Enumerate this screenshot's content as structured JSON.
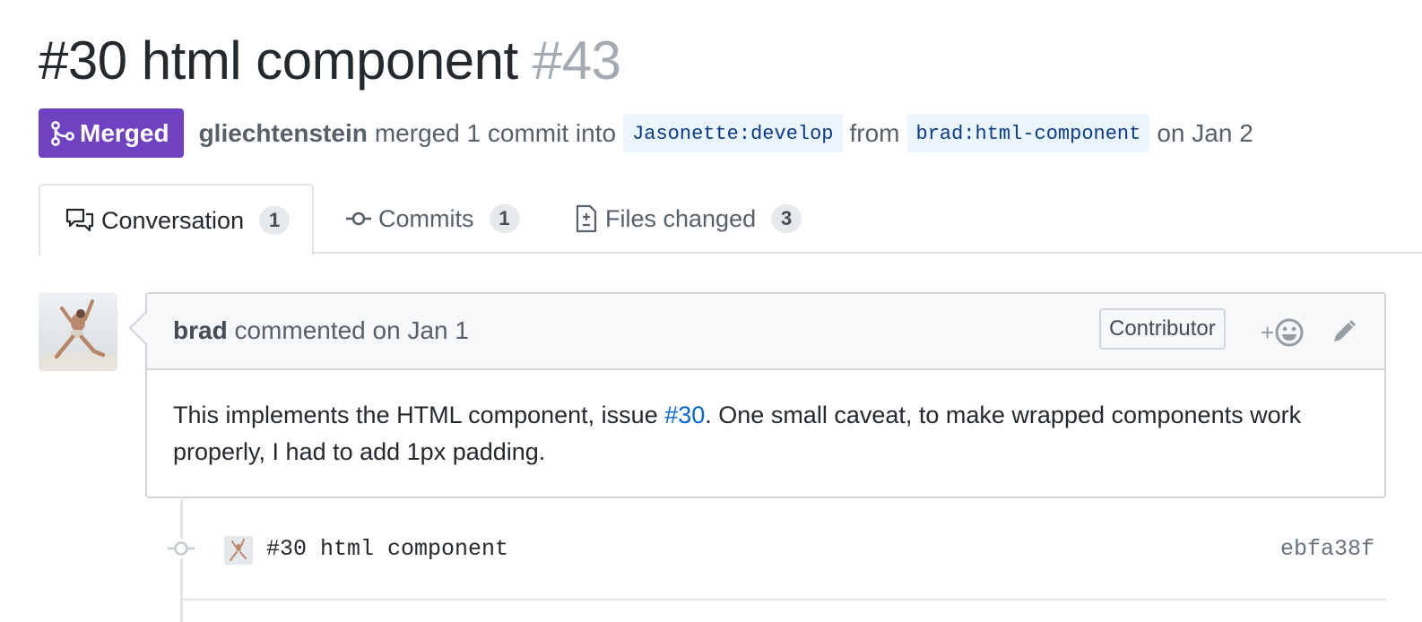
{
  "pr": {
    "title": "#30 html component",
    "number": "#43",
    "state_label": "Merged",
    "merged_by": "gliechtenstein",
    "merge_text": "merged 1 commit into",
    "base_branch": "Jasonette:develop",
    "from_text": "from",
    "head_branch": "brad:html-component",
    "date_text": "on Jan 2"
  },
  "tabs": [
    {
      "label": "Conversation",
      "count": "1",
      "icon": "comment-discussion-icon"
    },
    {
      "label": "Commits",
      "count": "1",
      "icon": "git-commit-icon"
    },
    {
      "label": "Files changed",
      "count": "3",
      "icon": "file-diff-icon"
    }
  ],
  "comment": {
    "author": "brad",
    "action": "commented on Jan 1",
    "role_badge": "Contributor",
    "reaction_plus": "+",
    "body_before": "This implements the HTML component, issue ",
    "body_link": "#30",
    "body_after": ". One small caveat, to make wrapped components work properly, I had to add 1px padding."
  },
  "commit": {
    "message": "#30 html component",
    "sha": "ebfa38f"
  },
  "colors": {
    "merged": "#6f42c1",
    "link": "#0366d6",
    "branch_bg": "#eaf5ff",
    "branch_fg": "#0b3a8f"
  }
}
